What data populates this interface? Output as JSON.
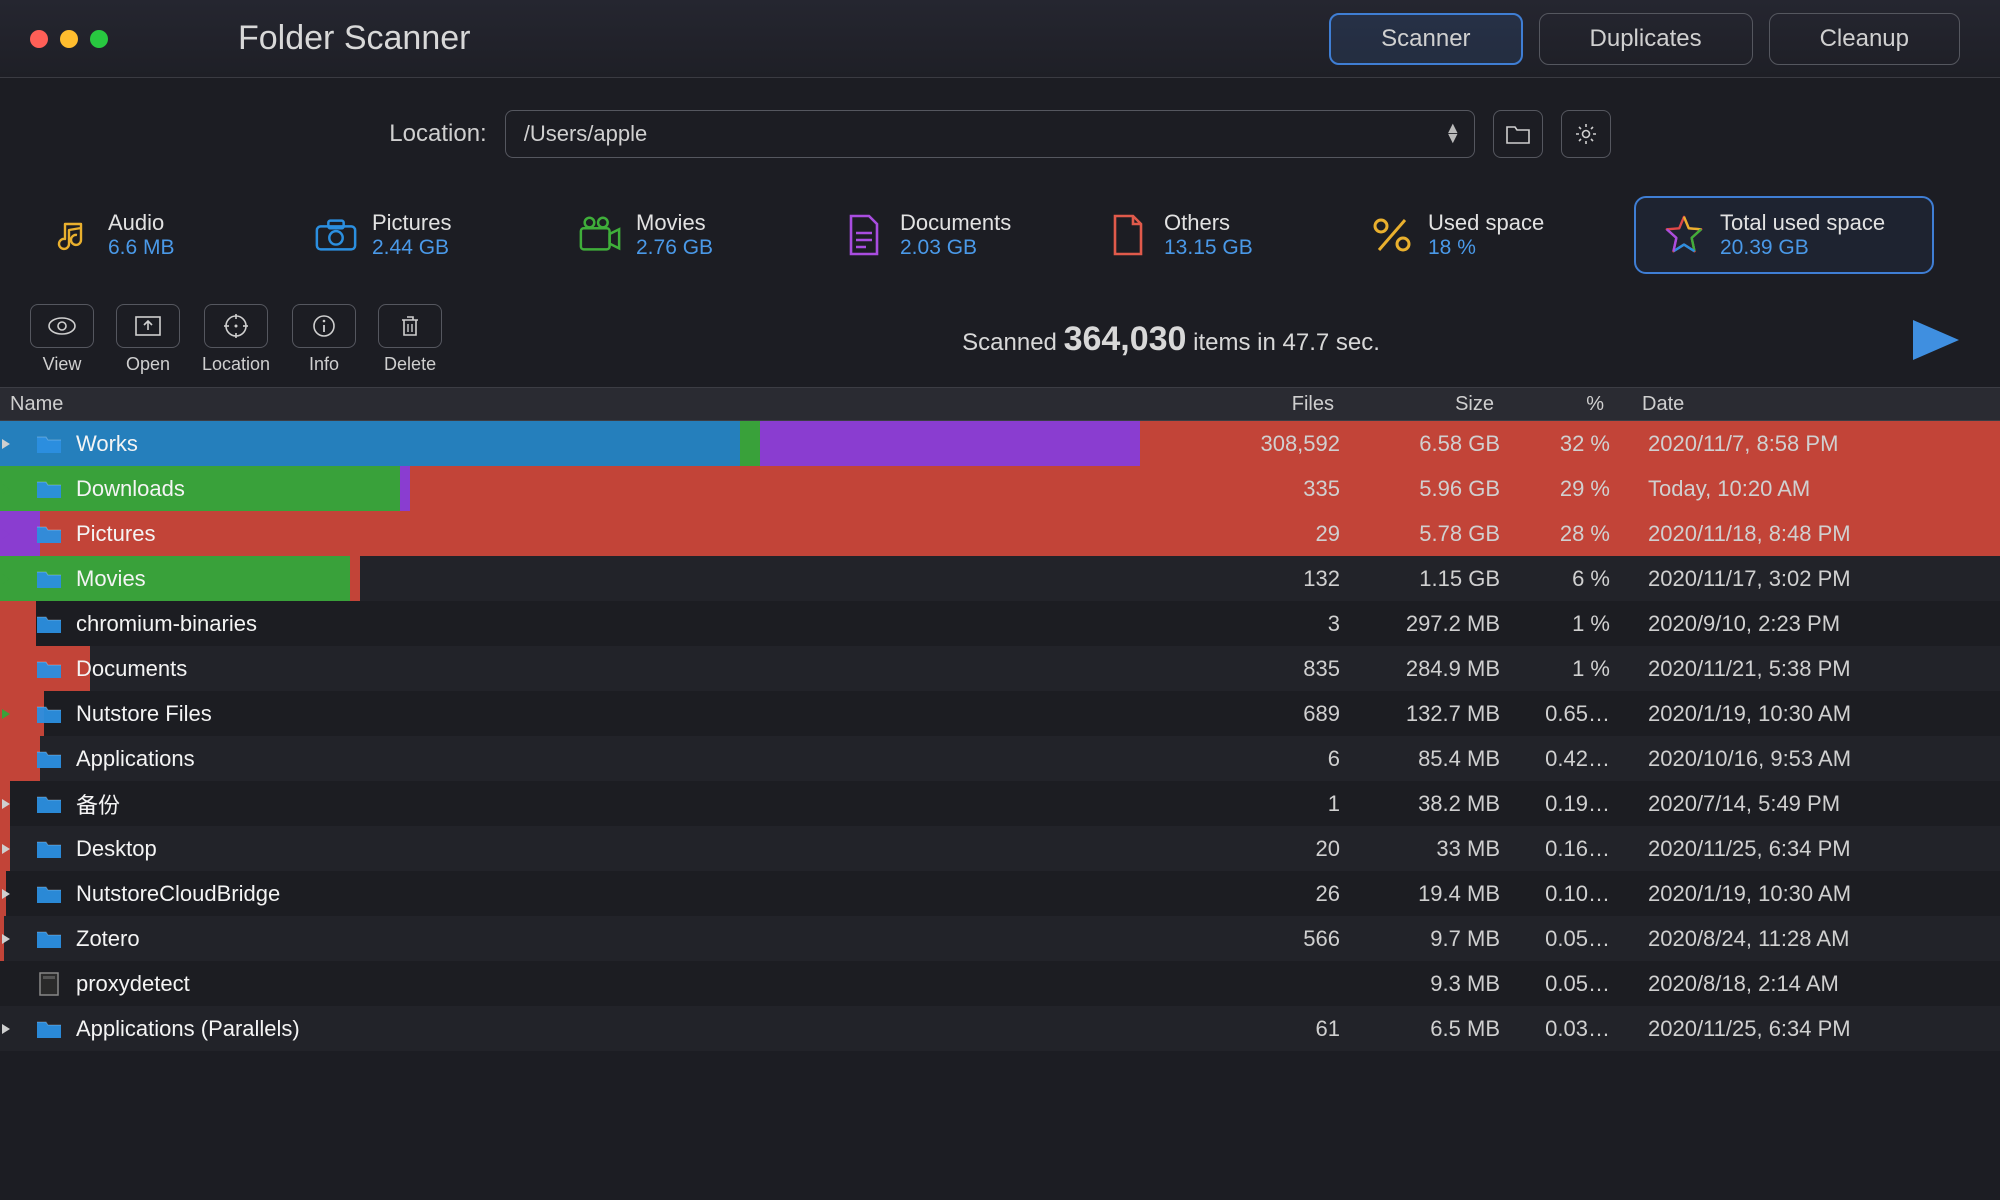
{
  "app_title": "Folder Scanner",
  "segmented": {
    "scanner": "Scanner",
    "duplicates": "Duplicates",
    "cleanup": "Cleanup"
  },
  "location": {
    "label": "Location:",
    "path": "/Users/apple"
  },
  "stats": {
    "audio": {
      "label": "Audio",
      "value": "6.6 MB",
      "color": "#e9b02e"
    },
    "pictures": {
      "label": "Pictures",
      "value": "2.44 GB",
      "color": "#2b8fe0"
    },
    "movies": {
      "label": "Movies",
      "value": "2.76 GB",
      "color": "#3fae3a"
    },
    "documents": {
      "label": "Documents",
      "value": "2.03 GB",
      "color": "#a94de0"
    },
    "others": {
      "label": "Others",
      "value": "13.15 GB",
      "color": "#e05a4b"
    },
    "used": {
      "label": "Used space",
      "value": "18 %",
      "color": "#e9b02e"
    },
    "total": {
      "label": "Total used space",
      "value": "20.39 GB"
    }
  },
  "toolbar": {
    "view": "View",
    "open": "Open",
    "location_btn": "Location",
    "info": "Info",
    "delete": "Delete"
  },
  "scan_status": {
    "prefix": "Scanned",
    "count": "364,030",
    "mid": "items in",
    "time": "47.7 sec."
  },
  "columns": {
    "name": "Name",
    "files": "Files",
    "size": "Size",
    "pct": "%",
    "date": "Date"
  },
  "rows": [
    {
      "name": "Works",
      "files": "308,592",
      "size": "6.58 GB",
      "pct": "32 %",
      "date": "2020/11/7, 8:58 PM",
      "bars": [
        [
          "#257fbc",
          37
        ],
        [
          "#39a13a",
          38
        ],
        [
          "#8a3dd0",
          57
        ],
        [
          "#c24438",
          100
        ]
      ],
      "icon_tint": "#2b8fe0"
    },
    {
      "name": "Downloads",
      "files": "335",
      "size": "5.96 GB",
      "pct": "29 %",
      "date": "Today, 10:20 AM",
      "bars": [
        [
          "#39a13a",
          20
        ],
        [
          "#8a3dd0",
          20.5
        ],
        [
          "#c24438",
          100
        ]
      ],
      "icon_tint": "#2b8fe0",
      "disclosure_color": "#39a13a"
    },
    {
      "name": "Pictures",
      "files": "29",
      "size": "5.78 GB",
      "pct": "28 %",
      "date": "2020/11/18, 8:48 PM",
      "bars": [
        [
          "#8a3dd0",
          2
        ],
        [
          "#c24438",
          100
        ]
      ],
      "icon_tint": "#2b8fe0",
      "disclosure_color": "#8a3dd0"
    },
    {
      "name": "Movies",
      "files": "132",
      "size": "1.15 GB",
      "pct": "6 %",
      "date": "2020/11/17, 3:02 PM",
      "bars": [
        [
          "#39a13a",
          17.5
        ],
        [
          "#c24438",
          18
        ]
      ],
      "icon_tint": "#2b8fe0",
      "disclosure_color": "#39a13a"
    },
    {
      "name": "chromium-binaries",
      "files": "3",
      "size": "297.2 MB",
      "pct": "1 %",
      "date": "2020/9/10, 2:23 PM",
      "bars": [
        [
          "#c24438",
          1.8
        ]
      ],
      "icon_tint": "#2b8fe0",
      "disclosure_color": "#c24438"
    },
    {
      "name": "Documents",
      "files": "835",
      "size": "284.9 MB",
      "pct": "1 %",
      "date": "2020/11/21, 5:38 PM",
      "bars": [
        [
          "#c24438",
          4.5
        ]
      ],
      "icon_tint": "#2b8fe0",
      "disclosure_color": "#c24438"
    },
    {
      "name": "Nutstore Files",
      "files": "689",
      "size": "132.7 MB",
      "pct": "0.65…",
      "date": "2020/1/19, 10:30 AM",
      "bars": [
        [
          "#c24438",
          2.2
        ]
      ],
      "icon_tint": "#2b8fe0",
      "disclosure_color": "#39a13a"
    },
    {
      "name": "Applications",
      "files": "6",
      "size": "85.4 MB",
      "pct": "0.42…",
      "date": "2020/10/16, 9:53 AM",
      "bars": [
        [
          "#c24438",
          2
        ]
      ],
      "icon_tint": "#2b8fe0",
      "disclosure_color": "#c24438"
    },
    {
      "name": "备份",
      "files": "1",
      "size": "38.2 MB",
      "pct": "0.19…",
      "date": "2020/7/14, 5:49 PM",
      "bars": [
        [
          "#c24438",
          0.5
        ]
      ],
      "icon_tint": "#2b8fe0"
    },
    {
      "name": "Desktop",
      "files": "20",
      "size": "33 MB",
      "pct": "0.16…",
      "date": "2020/11/25, 6:34 PM",
      "bars": [
        [
          "#c24438",
          0.5
        ]
      ],
      "icon_tint": "#2b8fe0"
    },
    {
      "name": "NutstoreCloudBridge",
      "files": "26",
      "size": "19.4 MB",
      "pct": "0.10…",
      "date": "2020/1/19, 10:30 AM",
      "bars": [
        [
          "#c24438",
          0.3
        ]
      ],
      "icon_tint": "#2b8fe0"
    },
    {
      "name": "Zotero",
      "files": "566",
      "size": "9.7 MB",
      "pct": "0.05…",
      "date": "2020/8/24, 11:28 AM",
      "bars": [
        [
          "#c24438",
          0.2
        ]
      ],
      "icon_tint": "#2b8fe0"
    },
    {
      "name": "proxydetect",
      "files": "",
      "size": "9.3 MB",
      "pct": "0.05…",
      "date": "2020/8/18, 2:14 AM",
      "bars": [],
      "icon_tint": "#888",
      "file_icon": true,
      "no_disclosure": true
    },
    {
      "name": "Applications (Parallels)",
      "files": "61",
      "size": "6.5 MB",
      "pct": "0.03…",
      "date": "2020/11/25, 6:34 PM",
      "bars": [],
      "icon_tint": "#2b8fe0"
    }
  ]
}
